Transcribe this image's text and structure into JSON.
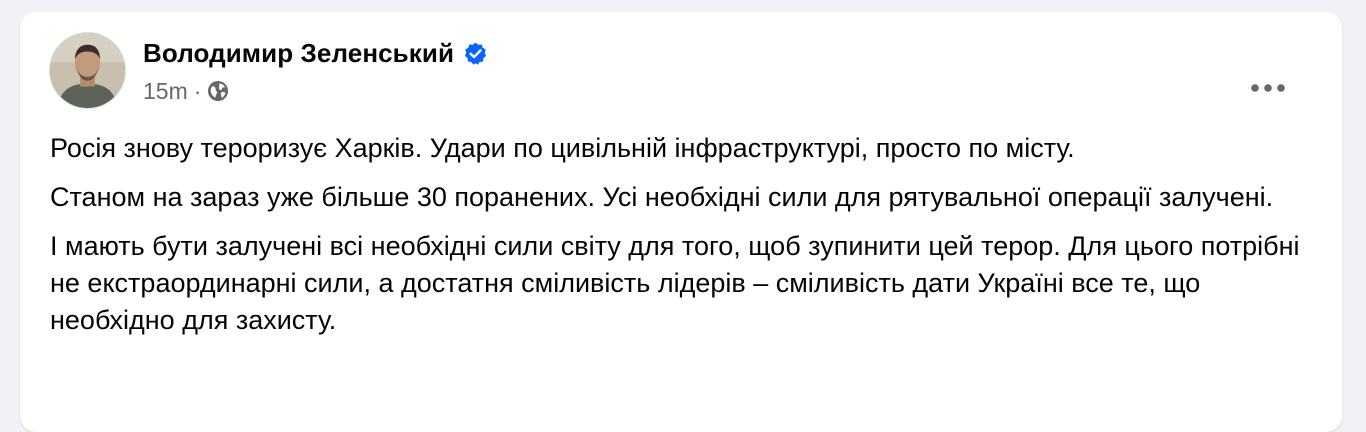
{
  "post": {
    "author": {
      "name": "Володимир Зеленський",
      "verified": true,
      "avatar": "profile-photo"
    },
    "timestamp": "15m",
    "separator": "·",
    "audience_icon": "globe-icon",
    "more_icon": "more-options-icon",
    "paragraphs": [
      "Росія знову тероризує Харків. Удари по цивільній інфраструктурі, просто по місту.",
      "Станом на зараз уже більше 30 поранених. Усі необхідні сили для рятувальної операції залучені.",
      "І мають бути залучені всі необхідні сили світу для того, щоб зупинити цей терор. Для цього потрібні не екстраординарні сили, а достатня сміливість лідерів – сміливість дати Україні все те, що необхідно для захисту."
    ]
  },
  "colors": {
    "background": "#f0f2f5",
    "card": "#ffffff",
    "text_primary": "#050505",
    "text_secondary": "#65676b",
    "verified_blue": "#0866ff"
  }
}
